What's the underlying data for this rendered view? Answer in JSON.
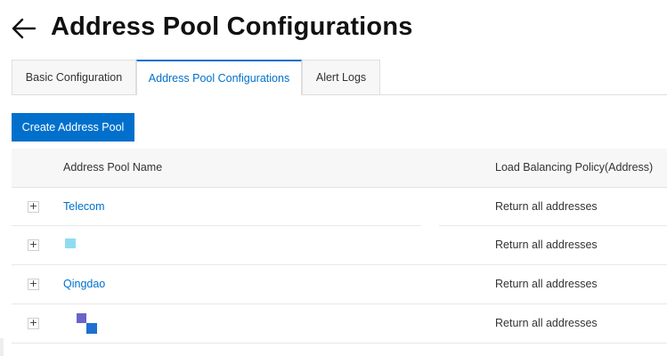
{
  "header": {
    "title": "Address Pool Configurations",
    "back_icon": "arrow-left-icon"
  },
  "tabs": [
    {
      "label": "Basic Configuration",
      "active": false
    },
    {
      "label": "Address Pool Configurations",
      "active": true
    },
    {
      "label": "Alert Logs",
      "active": false
    }
  ],
  "toolbar": {
    "create_label": "Create Address Pool"
  },
  "table": {
    "columns": {
      "name": "Address Pool Name",
      "policy": "Load Balancing Policy(Address)"
    },
    "rows": [
      {
        "name": "Telecom",
        "policy": "Return all addresses",
        "expand": "+"
      },
      {
        "name": "",
        "policy": "Return all addresses",
        "expand": "+"
      },
      {
        "name": "Qingdao",
        "policy": "Return all addresses",
        "expand": "+"
      },
      {
        "name": "",
        "policy": "Return all addresses",
        "expand": "+"
      }
    ]
  },
  "colors": {
    "accent": "#0070cc",
    "header_bg": "#f7f7f7"
  }
}
